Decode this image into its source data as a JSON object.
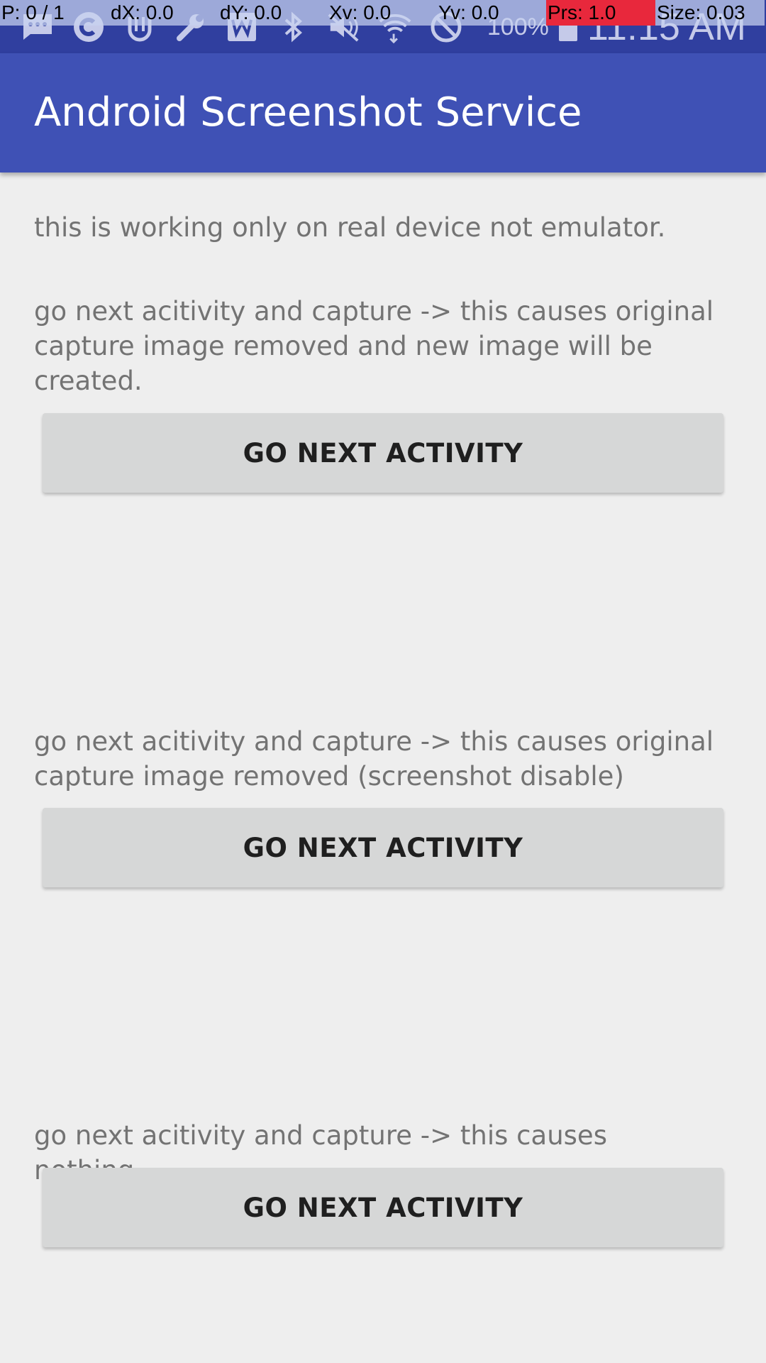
{
  "pointer_overlay": {
    "cells": [
      "P: 0 / 1",
      "dX: 0.0",
      "dY: 0.0",
      "Xv: 0.0",
      "Yv: 0.0",
      "Prs: 1.0",
      "Size: 0.03"
    ],
    "alert_color": "#e8283c"
  },
  "status_bar": {
    "icons": [
      "message-icon",
      "c-app-icon",
      "tape-icon",
      "wrench-icon",
      "word-app-icon",
      "bluetooth-icon",
      "vibrate-mute-icon",
      "wifi-icon",
      "do-not-disturb-icon"
    ],
    "battery_percent": "100%",
    "time": "11:15 AM",
    "background": "#303f9f"
  },
  "app_bar": {
    "title": "Android Screenshot Service",
    "background": "#3f51b5"
  },
  "content": {
    "intro": "this is working only on real device not emulator.",
    "section1_desc": "go next acitivity and capture -> this causes original capture image removed and new image will be created.",
    "section1_button": "GO NEXT ACTIVITY",
    "section2_desc": "go next acitivity and capture -> this causes original capture image removed (screenshot disable)",
    "section2_button": "GO NEXT ACTIVITY",
    "section3_desc": "go next acitivity and capture -> this causes nothing.",
    "section3_button": "GO NEXT ACTIVITY"
  }
}
